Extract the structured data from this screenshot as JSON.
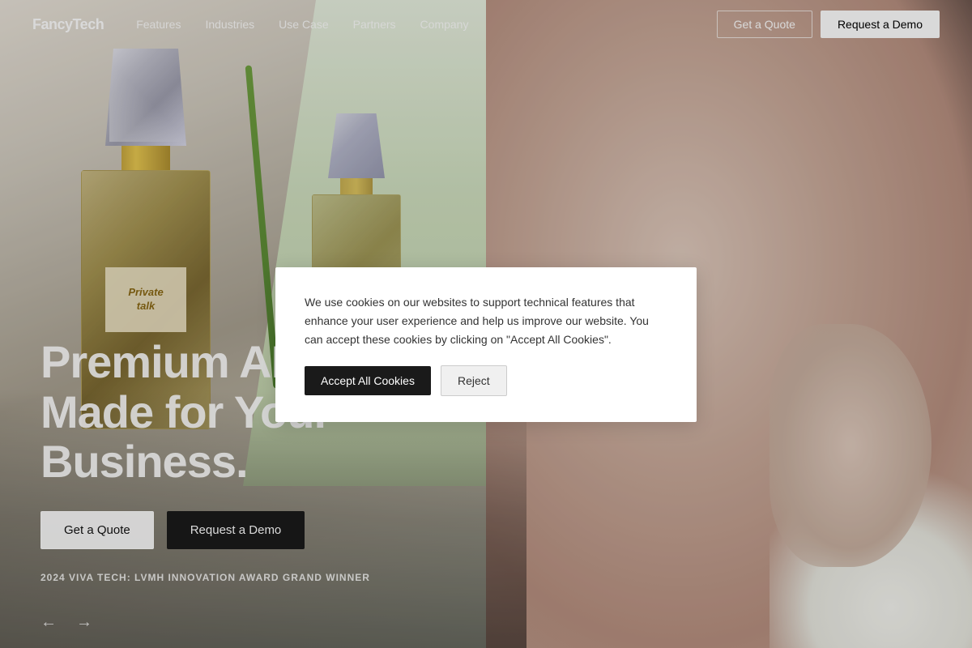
{
  "brand": {
    "name": "FancyTech"
  },
  "nav": {
    "links": [
      {
        "label": "Features",
        "id": "features"
      },
      {
        "label": "Industries",
        "id": "industries"
      },
      {
        "label": "Use Case",
        "id": "use-case"
      },
      {
        "label": "Partners",
        "id": "partners"
      },
      {
        "label": "Company",
        "id": "company"
      }
    ],
    "cta_quote": "Get a Quote",
    "cta_demo": "Request a Demo"
  },
  "hero": {
    "title_line1": "Premium AI Content,",
    "title_line2": "Made for Your Business.",
    "cta_quote": "Get a Quote",
    "cta_demo": "Request a Demo",
    "award": "2024 VIVA TECH: LVMH INNOVATION AWARD GRAND WINNER"
  },
  "carousel": {
    "prev": "←",
    "next": "→"
  },
  "cookie": {
    "text": "We use cookies on our websites to support technical features that enhance your user experience and help us improve our website. You can accept these cookies by clicking on \"Accept All Cookies\".",
    "accept_label": "Accept All Cookies",
    "reject_label": "Reject"
  },
  "perfume": {
    "label_line1": "Private",
    "label_line2": "talk"
  },
  "colors": {
    "dark": "#1a1a1a",
    "white": "#ffffff",
    "accent_gold": "#c8a840"
  }
}
